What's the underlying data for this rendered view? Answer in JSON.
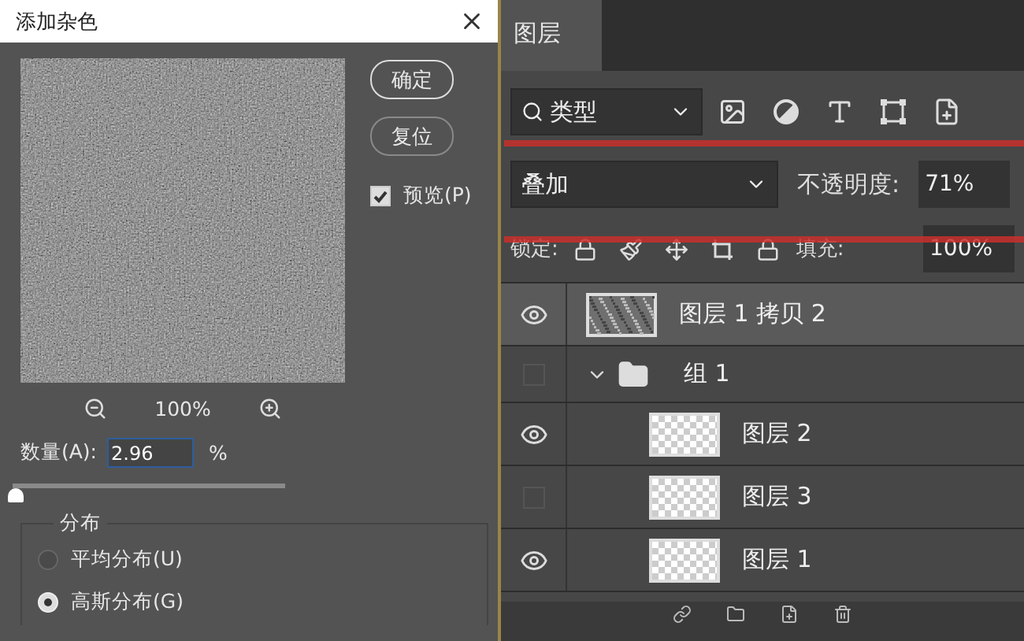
{
  "dialog": {
    "title": "添加杂色",
    "buttons": [
      "确定",
      "复位"
    ],
    "preview": {
      "label": "预览(P)",
      "checked": true
    },
    "zoom": "100%",
    "amount": {
      "label": "数量(A):",
      "value": "2.96",
      "unit": "%",
      "level": 0.01
    },
    "distribution": {
      "legend": "分布",
      "options": [
        {
          "label": "平均分布(U)",
          "selected": false
        },
        {
          "label": "高斯分布(G)",
          "selected": true
        }
      ]
    }
  },
  "layers_panel": {
    "tab": {
      "label": "图层",
      "selected": true
    },
    "filter": {
      "label": "类型"
    },
    "blend_mode": "叠加",
    "opacity": {
      "label": "不透明度:",
      "value": "71%"
    },
    "lock": {
      "label": "锁定:"
    },
    "fill": {
      "label": "填充:",
      "value": "100%"
    },
    "layers": [
      {
        "name": "图层 1 拷贝 2",
        "kind": "noise",
        "visible": true,
        "selected": true
      },
      {
        "name": "组 1",
        "kind": "group",
        "visible": false,
        "selected": false,
        "expanded": true,
        "children": [
          {
            "name": "图层 2",
            "kind": "pixel",
            "visible": true,
            "selected": false
          },
          {
            "name": "图层 3",
            "kind": "pixel",
            "visible": false,
            "selected": false
          },
          {
            "name": "图层 1",
            "kind": "pixel",
            "visible": true,
            "selected": false
          }
        ]
      }
    ]
  }
}
